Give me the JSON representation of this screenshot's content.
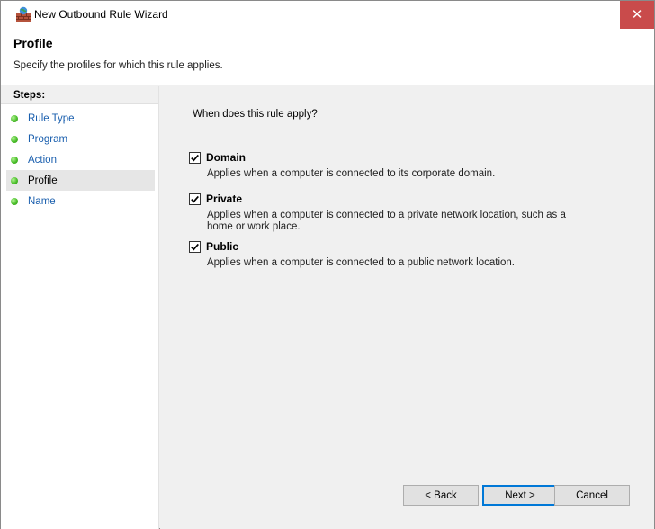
{
  "window": {
    "title": "New Outbound Rule Wizard",
    "close_glyph": "✕"
  },
  "header": {
    "title": "Profile",
    "subtitle": "Specify the profiles for which this rule applies."
  },
  "sidebar": {
    "heading": "Steps:",
    "steps": [
      {
        "label": "Rule Type",
        "active": false
      },
      {
        "label": "Program",
        "active": false
      },
      {
        "label": "Action",
        "active": false
      },
      {
        "label": "Profile",
        "active": true
      },
      {
        "label": "Name",
        "active": false
      }
    ]
  },
  "main": {
    "question": "When does this rule apply?",
    "options": [
      {
        "label": "Domain",
        "checked": true,
        "description": "Applies when a computer is connected to its corporate domain."
      },
      {
        "label": "Private",
        "checked": true,
        "description": "Applies when a computer is connected to a private network location, such as a home or work place."
      },
      {
        "label": "Public",
        "checked": true,
        "description": "Applies when a computer is connected to a public network location."
      }
    ]
  },
  "buttons": {
    "back": "< Back",
    "next": "Next >",
    "cancel": "Cancel"
  },
  "colors": {
    "close_button": "#c94b4b",
    "step_link": "#1a5fae",
    "step_dot": "#4bbf2b",
    "default_button_border": "#0078d7"
  }
}
